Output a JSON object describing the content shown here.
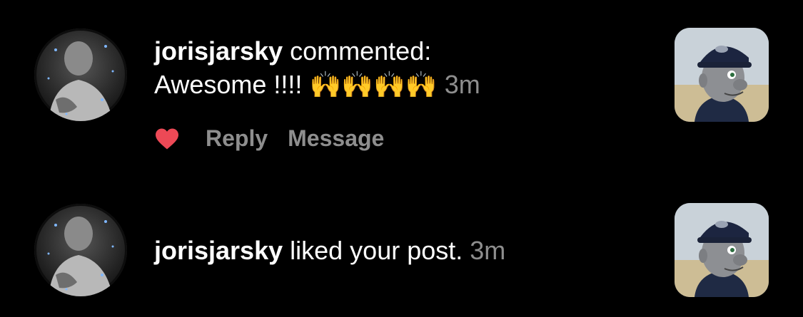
{
  "notifications": [
    {
      "username": "jorisjarsky",
      "action": "commented:",
      "comment": "Awesome !!!!",
      "emoji": "🙌🙌🙌🙌",
      "time": "3m",
      "actions": {
        "like_icon": "heart-filled-icon",
        "like_color": "#ed4956",
        "reply_label": "Reply",
        "message_label": "Message"
      }
    },
    {
      "username": "jorisjarsky",
      "action": "liked your post.",
      "time": "3m"
    }
  ],
  "colors": {
    "background": "#000000",
    "primary_text": "#ffffff",
    "secondary_text": "#8e8e8e",
    "like": "#ed4956"
  }
}
